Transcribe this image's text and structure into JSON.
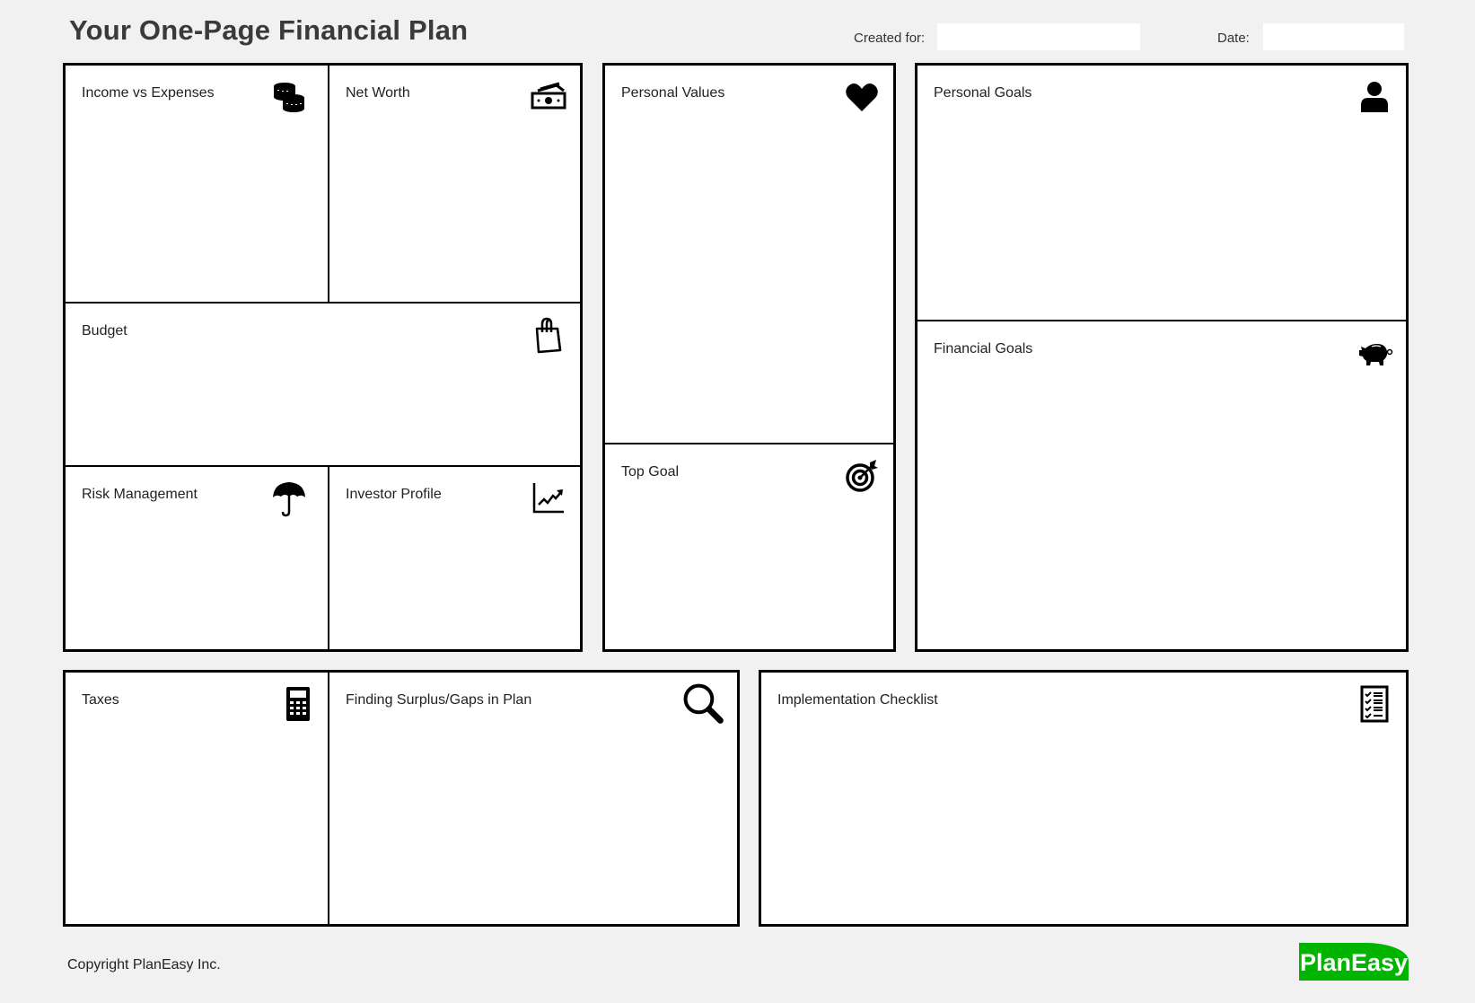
{
  "header": {
    "title": "Your One-Page Financial Plan",
    "created_for_label": "Created for:",
    "created_for_value": "",
    "date_label": "Date:",
    "date_value": ""
  },
  "sections": {
    "income_vs_expenses": {
      "label": "Income vs Expenses",
      "icon": "coins-icon"
    },
    "net_worth": {
      "label": "Net Worth",
      "icon": "cash-icon"
    },
    "budget": {
      "label": "Budget",
      "icon": "shopping-bag-icon"
    },
    "risk_management": {
      "label": "Risk Management",
      "icon": "umbrella-icon"
    },
    "investor_profile": {
      "label": "Investor Profile",
      "icon": "trend-chart-icon"
    },
    "personal_values": {
      "label": "Personal Values",
      "icon": "heart-icon"
    },
    "top_goal": {
      "label": "Top Goal",
      "icon": "target-icon"
    },
    "personal_goals": {
      "label": "Personal Goals",
      "icon": "person-icon"
    },
    "financial_goals": {
      "label": "Financial Goals",
      "icon": "piggy-bank-icon"
    },
    "taxes": {
      "label": "Taxes",
      "icon": "calculator-icon"
    },
    "finding_surplus": {
      "label": "Finding Surplus/Gaps in Plan",
      "icon": "magnifier-icon"
    },
    "implementation_checklist": {
      "label": "Implementation Checklist",
      "icon": "checklist-icon"
    }
  },
  "footer": {
    "copyright": "Copyright PlanEasy Inc.",
    "logo_text": "PlanEasy",
    "logo_color": "#00b400"
  }
}
